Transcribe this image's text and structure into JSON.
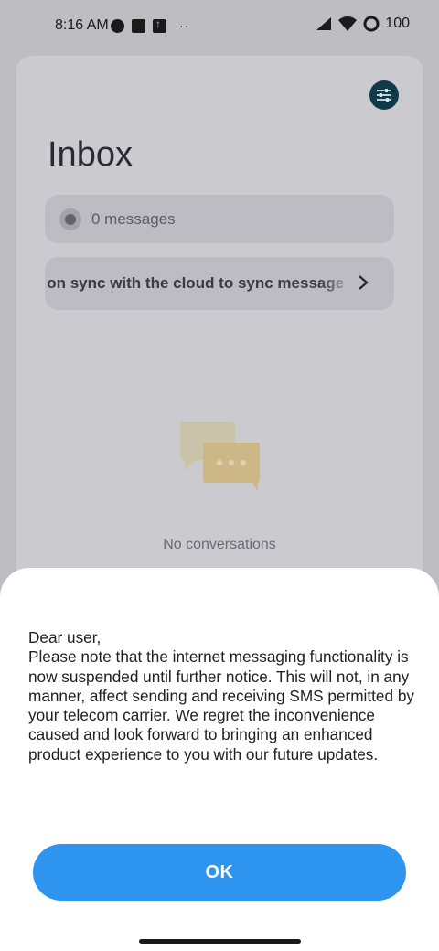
{
  "status_bar": {
    "time": "8:16 AM",
    "battery": "100",
    "icons": [
      "data-saver-icon",
      "square-notification-icon",
      "upload-notification-icon",
      "more-dots-icon",
      "signal-icon",
      "wifi-icon",
      "battery-icon"
    ],
    "more": "··"
  },
  "app": {
    "title": "Inbox",
    "message_count": "0 messages",
    "sync_banner": "Turn on sync with the cloud to sync messages",
    "empty_state": "No conversations",
    "accent_color": "#103a4a"
  },
  "dialog": {
    "greeting": "Dear user,",
    "body": "Please note that the internet messaging functionality is now suspended until further notice. This will not, in any manner, affect sending and receiving SMS permitted by your telecom carrier. We regret the inconvenience caused and look forward to bringing an enhanced product experience to you with our future updates.",
    "ok_label": "OK",
    "button_color": "#2d94f0"
  }
}
